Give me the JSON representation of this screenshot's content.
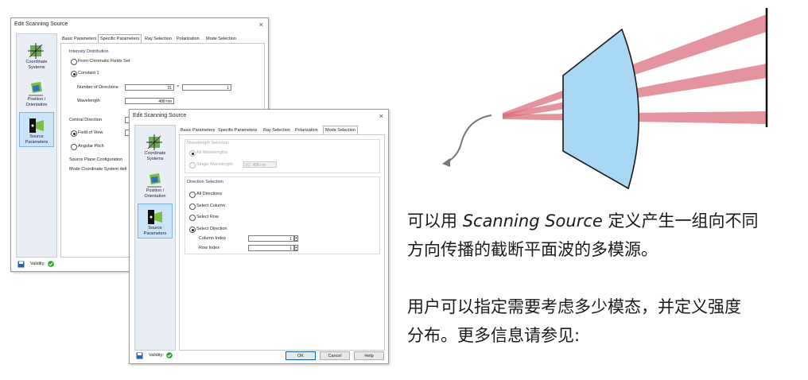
{
  "back_dialog": {
    "title": "Edit Scanning Source",
    "close": "×",
    "nav": [
      {
        "label1": "Coordinate",
        "label2": "Systems"
      },
      {
        "label1": "Position /",
        "label2": "Orientation"
      },
      {
        "label1": "Source",
        "label2": "Parameters"
      }
    ],
    "tabs": [
      "Basic Parameters",
      "Specific Parameters",
      "Ray Selection",
      "Polarization",
      "Mode Selection"
    ],
    "intensity_heading": "Intensity Distribution",
    "from_chromatic": "From Chromatic Fields Set",
    "constant": "Constant 1",
    "num_directions_label": "Number of Directions",
    "num_directions_x": "31",
    "times": "×",
    "num_directions_y": "1",
    "wavelength_label": "Wavelength",
    "wavelength_value": "488 nm",
    "central_direction": "Central Direction",
    "field_of_view": "Field of View",
    "angular_pitch": "Angular Pitch",
    "source_plane": "Source Plane Configuration",
    "mode_coord": "Mode Coordinate System defi",
    "validity": "Validity:"
  },
  "front_dialog": {
    "title": "Edit Scanning Source",
    "close": "×",
    "nav": [
      {
        "label1": "Coordinate",
        "label2": "Systems"
      },
      {
        "label1": "Position /",
        "label2": "Orientation"
      },
      {
        "label1": "Source",
        "label2": "Parameters"
      }
    ],
    "tabs": [
      "Basic Parameters",
      "Specific Parameters",
      "Ray Selection",
      "Polarization",
      "Mode Selection"
    ],
    "wavelength_selection": "Wavelength Selection",
    "all_wavelengths": "All Wavelengths",
    "single_wavelength": "Single Wavelength",
    "single_wavelength_value": "#1: 488 nm",
    "direction_selection": "Direction Selection",
    "all_directions": "All Directions",
    "select_column": "Select Column",
    "select_row": "Select Row",
    "select_direction": "Select Direction",
    "column_index_label": "Column Index",
    "column_index_value": "1",
    "row_index_label": "Row Index",
    "row_index_value": "1",
    "validity": "Validity:",
    "ok": "OK",
    "cancel": "Cancel",
    "help": "Help"
  },
  "description": {
    "line1_pre": "可以用 ",
    "line1_em": "Scanning Source",
    "line1_post": " 定义产生一组向不同",
    "line2": "方向传播的截断平面波的多模源。",
    "line3": "用户可以指定需要考虑多少模态，并定义强度",
    "line4": "分布。更多信息请参见:"
  },
  "colors": {
    "beam": "#d9707f",
    "lens_fill": "#a8d8f4",
    "lens_stroke": "#1a1a1a",
    "active_nav": "#cce4f7",
    "validity_ok": "#2aa02a"
  }
}
